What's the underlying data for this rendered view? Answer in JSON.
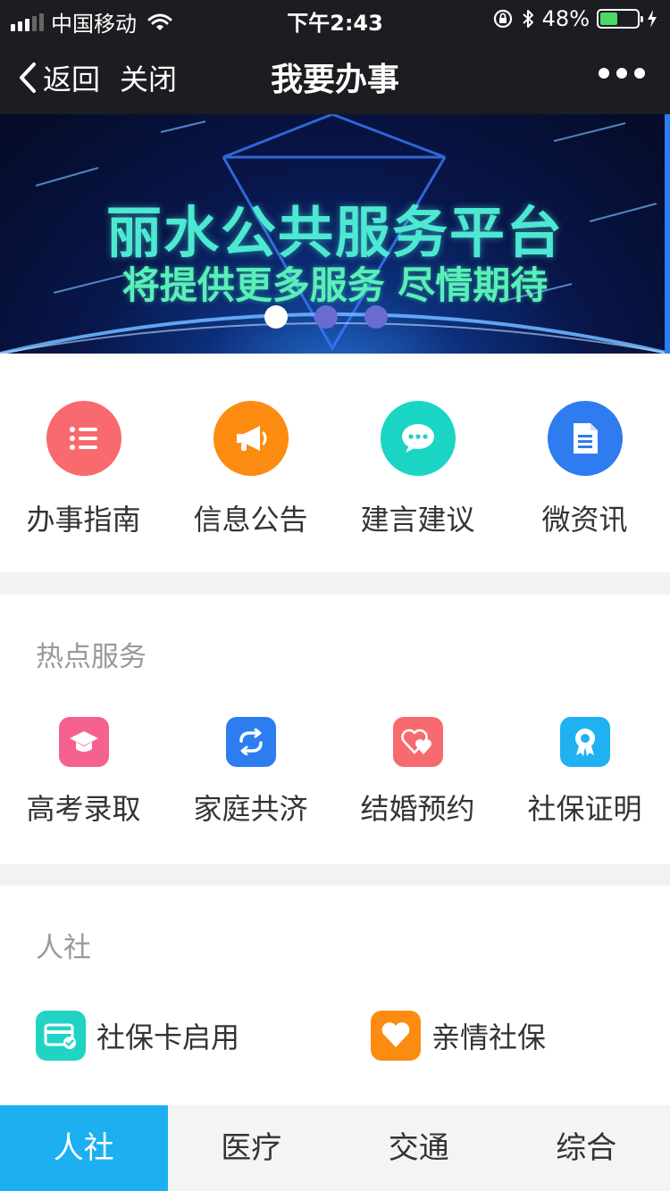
{
  "status_bar": {
    "carrier": "中国移动",
    "time": "下午2:43",
    "battery": "48%",
    "battery_level": 0.48
  },
  "nav": {
    "back_label": "返回",
    "close_label": "关闭",
    "title": "我要办事"
  },
  "banner": {
    "line1": "丽水公共服务平台",
    "line2": "将提供更多服务 尽情期待",
    "slide_count": 3,
    "active_slide": 1
  },
  "quick_actions": [
    {
      "label": "办事指南",
      "icon": "list-icon",
      "color": "#f96a6e"
    },
    {
      "label": "信息公告",
      "icon": "megaphone-icon",
      "color": "#fb8c11"
    },
    {
      "label": "建言建议",
      "icon": "chat-icon",
      "color": "#1bd5c4"
    },
    {
      "label": "微资讯",
      "icon": "document-icon",
      "color": "#2f7bf0"
    }
  ],
  "hot_services": {
    "title": "热点服务",
    "items": [
      {
        "label": "高考录取",
        "icon": "graduation-cap-icon",
        "color": "#f6628f"
      },
      {
        "label": "家庭共济",
        "icon": "refresh-icon",
        "color": "#2d7cf0"
      },
      {
        "label": "结婚预约",
        "icon": "hearts-icon",
        "color": "#f76b6e"
      },
      {
        "label": "社保证明",
        "icon": "certificate-icon",
        "color": "#1fb1f0"
      }
    ]
  },
  "renshe": {
    "title": "人社",
    "items": [
      {
        "label": "社保卡启用",
        "icon": "card-check-icon",
        "color": "#21d3c3"
      },
      {
        "label": "亲情社保",
        "icon": "heart-icon",
        "color": "#fb8c11"
      }
    ]
  },
  "tabs": [
    {
      "label": "人社",
      "active": true
    },
    {
      "label": "医疗",
      "active": false
    },
    {
      "label": "交通",
      "active": false
    },
    {
      "label": "综合",
      "active": false
    }
  ]
}
